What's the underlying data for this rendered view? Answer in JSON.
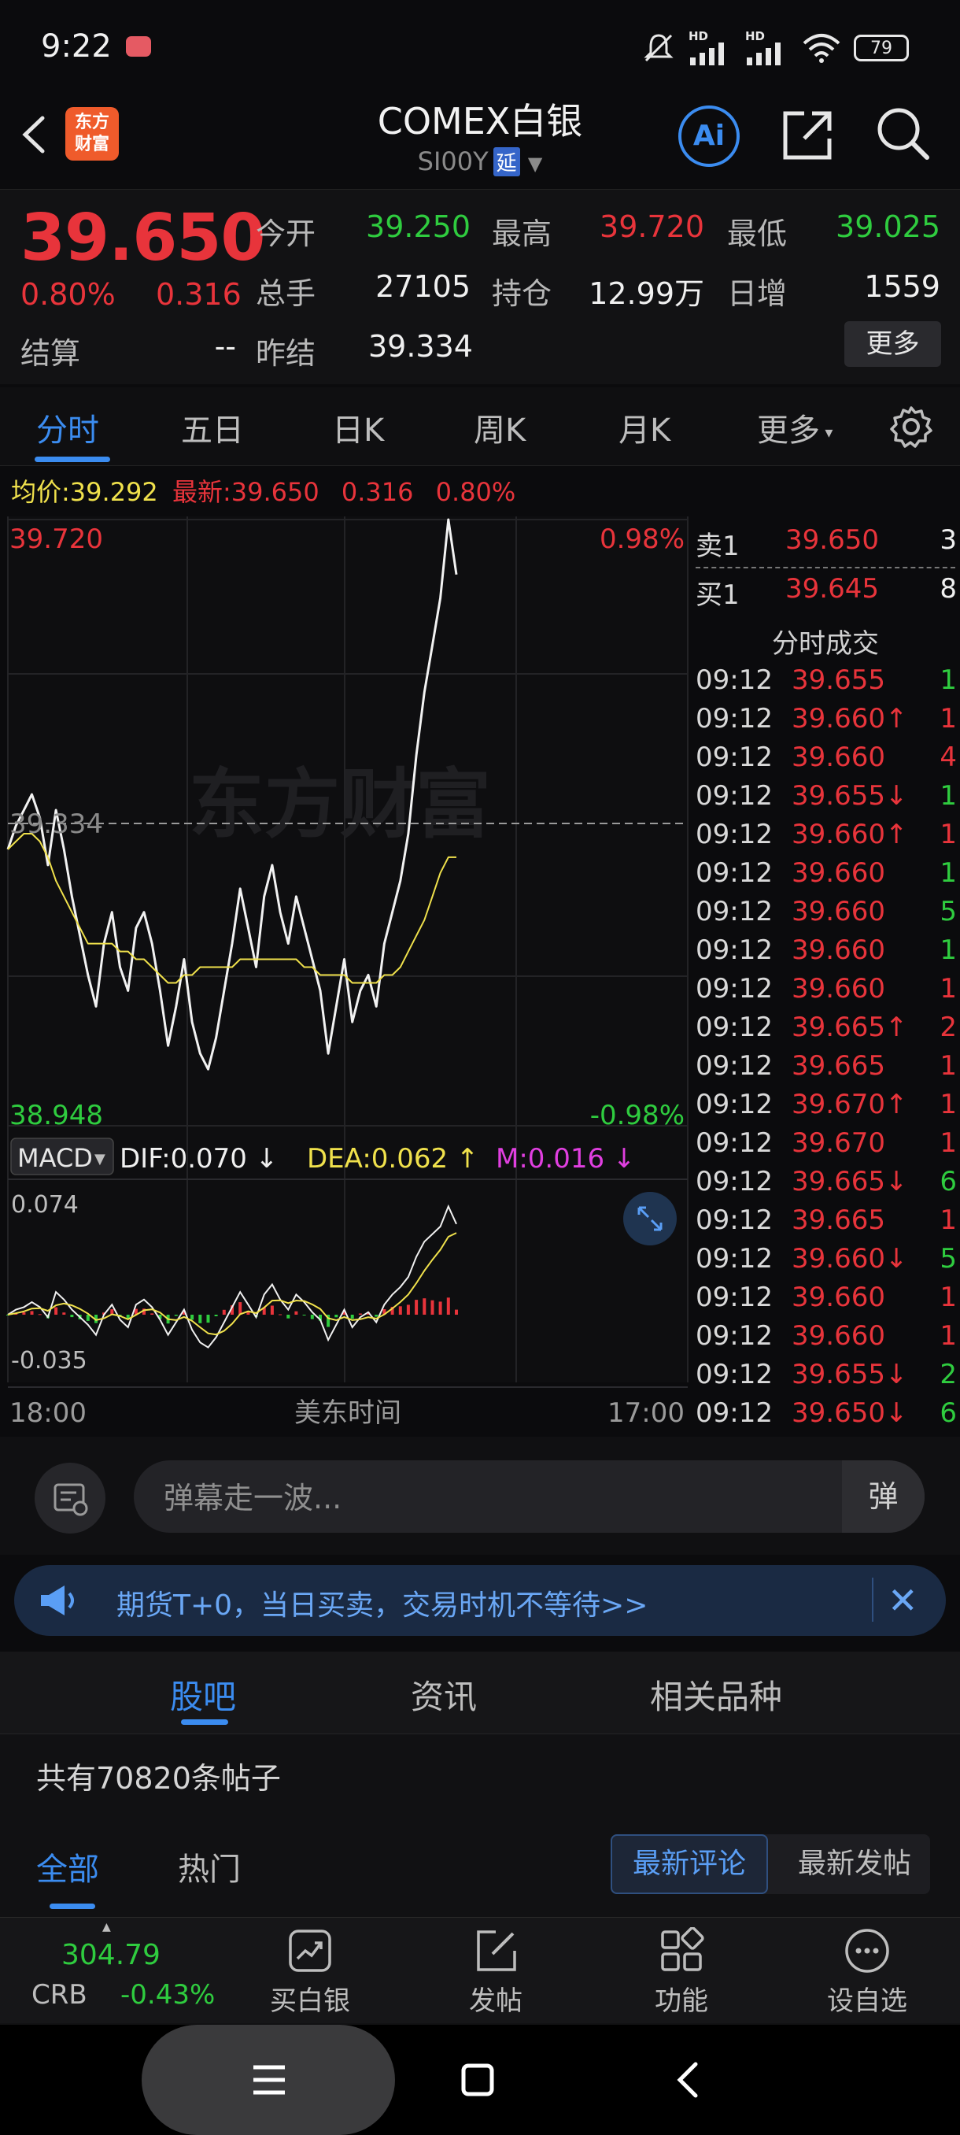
{
  "status_bar": {
    "time": "9:22",
    "battery": "79",
    "signal_1": "HD",
    "signal_2": "HD"
  },
  "header": {
    "title": "COMEX白银",
    "symbol": "SI00Y",
    "delay_tag": "延",
    "logo_line1": "东方",
    "logo_line2": "财富",
    "ai_label": "Ai"
  },
  "quote": {
    "price": "39.650",
    "change_pct": "0.80%",
    "change": "0.316",
    "fields": [
      {
        "label": "今开",
        "value": "39.250",
        "color": "green"
      },
      {
        "label": "最高",
        "value": "39.720",
        "color": "red"
      },
      {
        "label": "最低",
        "value": "39.025",
        "color": "green"
      },
      {
        "label": "总手",
        "value": "27105",
        "color": "white"
      },
      {
        "label": "持仓",
        "value": "12.99万",
        "color": "white"
      },
      {
        "label": "日增",
        "value": "1559",
        "color": "white"
      },
      {
        "label": "结算",
        "value": "--",
        "color": "white"
      },
      {
        "label": "昨结",
        "value": "39.334",
        "color": "white"
      }
    ],
    "more_button": "更多"
  },
  "tabs": [
    "分时",
    "五日",
    "日K",
    "周K",
    "月K",
    "更多"
  ],
  "avg_line": {
    "avg_label": "均价:",
    "avg_value": "39.292",
    "latest_label": "最新:",
    "latest_value": "39.650",
    "change": "0.316",
    "change_pct": "0.80%"
  },
  "chart": {
    "y_max_label": "39.720",
    "y_max_pct": "0.98%",
    "y_mid_label": "39.334",
    "y_min_label": "38.948",
    "y_min_pct": "-0.98%",
    "watermark": "东方财富",
    "macd_label": "MACD",
    "dif": "DIF:0.070",
    "dea": "DEA:0.062",
    "m": "M:0.016",
    "macd_max": "0.074",
    "macd_min": "-0.035",
    "x_start": "18:00",
    "x_mid": "美东时间",
    "x_end": "17:00"
  },
  "chart_data": {
    "type": "line",
    "title": "",
    "xlabel": "美东时间",
    "ylabel": "",
    "ylim": [
      38.948,
      39.72
    ],
    "prev_settle": 39.334,
    "x": [
      "18:00",
      "17:00"
    ],
    "series": [
      {
        "name": "价格",
        "values": [
          39.3,
          39.33,
          39.35,
          39.37,
          39.34,
          39.28,
          39.35,
          39.3,
          39.24,
          39.19,
          39.14,
          39.1,
          39.18,
          39.22,
          39.15,
          39.12,
          39.2,
          39.22,
          39.18,
          39.12,
          39.05,
          39.1,
          39.16,
          39.08,
          39.04,
          39.02,
          39.06,
          39.12,
          39.18,
          39.25,
          39.2,
          39.15,
          39.24,
          39.28,
          39.22,
          39.18,
          39.24,
          39.2,
          39.16,
          39.12,
          39.04,
          39.1,
          39.16,
          39.08,
          39.12,
          39.14,
          39.1,
          39.18,
          39.22,
          39.26,
          39.32,
          39.42,
          39.5,
          39.56,
          39.62,
          39.72,
          39.65
        ]
      },
      {
        "name": "均价",
        "values": [
          39.3,
          39.31,
          39.32,
          39.32,
          39.31,
          39.29,
          39.26,
          39.24,
          39.22,
          39.2,
          39.18,
          39.18,
          39.18,
          39.18,
          39.17,
          39.17,
          39.16,
          39.16,
          39.15,
          39.14,
          39.13,
          39.13,
          39.14,
          39.14,
          39.15,
          39.15,
          39.15,
          39.15,
          39.15,
          39.16,
          39.16,
          39.16,
          39.16,
          39.16,
          39.16,
          39.16,
          39.16,
          39.15,
          39.15,
          39.14,
          39.14,
          39.14,
          39.14,
          39.13,
          39.13,
          39.13,
          39.13,
          39.14,
          39.14,
          39.15,
          39.17,
          39.19,
          39.21,
          39.24,
          39.27,
          39.29,
          39.29
        ]
      }
    ]
  },
  "order_book": [
    {
      "label": "卖1",
      "price": "39.650",
      "vol": "3"
    },
    {
      "label": "买1",
      "price": "39.645",
      "vol": "8"
    }
  ],
  "trades_title": "分时成交",
  "trades": [
    {
      "time": "09:12",
      "price": "39.655",
      "dir": "",
      "vol": "1",
      "vc": "green"
    },
    {
      "time": "09:12",
      "price": "39.660",
      "dir": "↑",
      "vol": "1",
      "vc": "red"
    },
    {
      "time": "09:12",
      "price": "39.660",
      "dir": "",
      "vol": "4",
      "vc": "red"
    },
    {
      "time": "09:12",
      "price": "39.655",
      "dir": "↓",
      "vol": "1",
      "vc": "green"
    },
    {
      "time": "09:12",
      "price": "39.660",
      "dir": "↑",
      "vol": "1",
      "vc": "red"
    },
    {
      "time": "09:12",
      "price": "39.660",
      "dir": "",
      "vol": "1",
      "vc": "green"
    },
    {
      "time": "09:12",
      "price": "39.660",
      "dir": "",
      "vol": "5",
      "vc": "green"
    },
    {
      "time": "09:12",
      "price": "39.660",
      "dir": "",
      "vol": "1",
      "vc": "green"
    },
    {
      "time": "09:12",
      "price": "39.660",
      "dir": "",
      "vol": "1",
      "vc": "red"
    },
    {
      "time": "09:12",
      "price": "39.665",
      "dir": "↑",
      "vol": "2",
      "vc": "red"
    },
    {
      "time": "09:12",
      "price": "39.665",
      "dir": "",
      "vol": "1",
      "vc": "red"
    },
    {
      "time": "09:12",
      "price": "39.670",
      "dir": "↑",
      "vol": "1",
      "vc": "red"
    },
    {
      "time": "09:12",
      "price": "39.670",
      "dir": "",
      "vol": "1",
      "vc": "red"
    },
    {
      "time": "09:12",
      "price": "39.665",
      "dir": "↓",
      "vol": "6",
      "vc": "green"
    },
    {
      "time": "09:12",
      "price": "39.665",
      "dir": "",
      "vol": "1",
      "vc": "red"
    },
    {
      "time": "09:12",
      "price": "39.660",
      "dir": "↓",
      "vol": "5",
      "vc": "green"
    },
    {
      "time": "09:12",
      "price": "39.660",
      "dir": "",
      "vol": "1",
      "vc": "red"
    },
    {
      "time": "09:12",
      "price": "39.660",
      "dir": "",
      "vol": "1",
      "vc": "red"
    },
    {
      "time": "09:12",
      "price": "39.655",
      "dir": "↓",
      "vol": "2",
      "vc": "green"
    },
    {
      "time": "09:12",
      "price": "39.650",
      "dir": "↓",
      "vol": "6",
      "vc": "green"
    }
  ],
  "comment": {
    "placeholder": "弹幕走一波...",
    "danmaku": "弹"
  },
  "banner": {
    "text": "期货T+0，当日买卖，交易时机不等待>>"
  },
  "forum": {
    "tabs": [
      "股吧",
      "资讯",
      "相关品种"
    ],
    "post_count": "共有70820条帖子",
    "subtabs": [
      "全部",
      "热门"
    ],
    "sort": [
      "最新评论",
      "最新发帖"
    ]
  },
  "toolbar": {
    "crb_value": "304.79",
    "crb_label": "CRB",
    "crb_change": "-0.43%",
    "items": [
      "买白银",
      "发帖",
      "功能",
      "设自选"
    ]
  },
  "colors": {
    "up": "#e8343b",
    "down": "#2fcc3f",
    "accent": "#3b8cf0",
    "avg": "#f0e14c"
  }
}
